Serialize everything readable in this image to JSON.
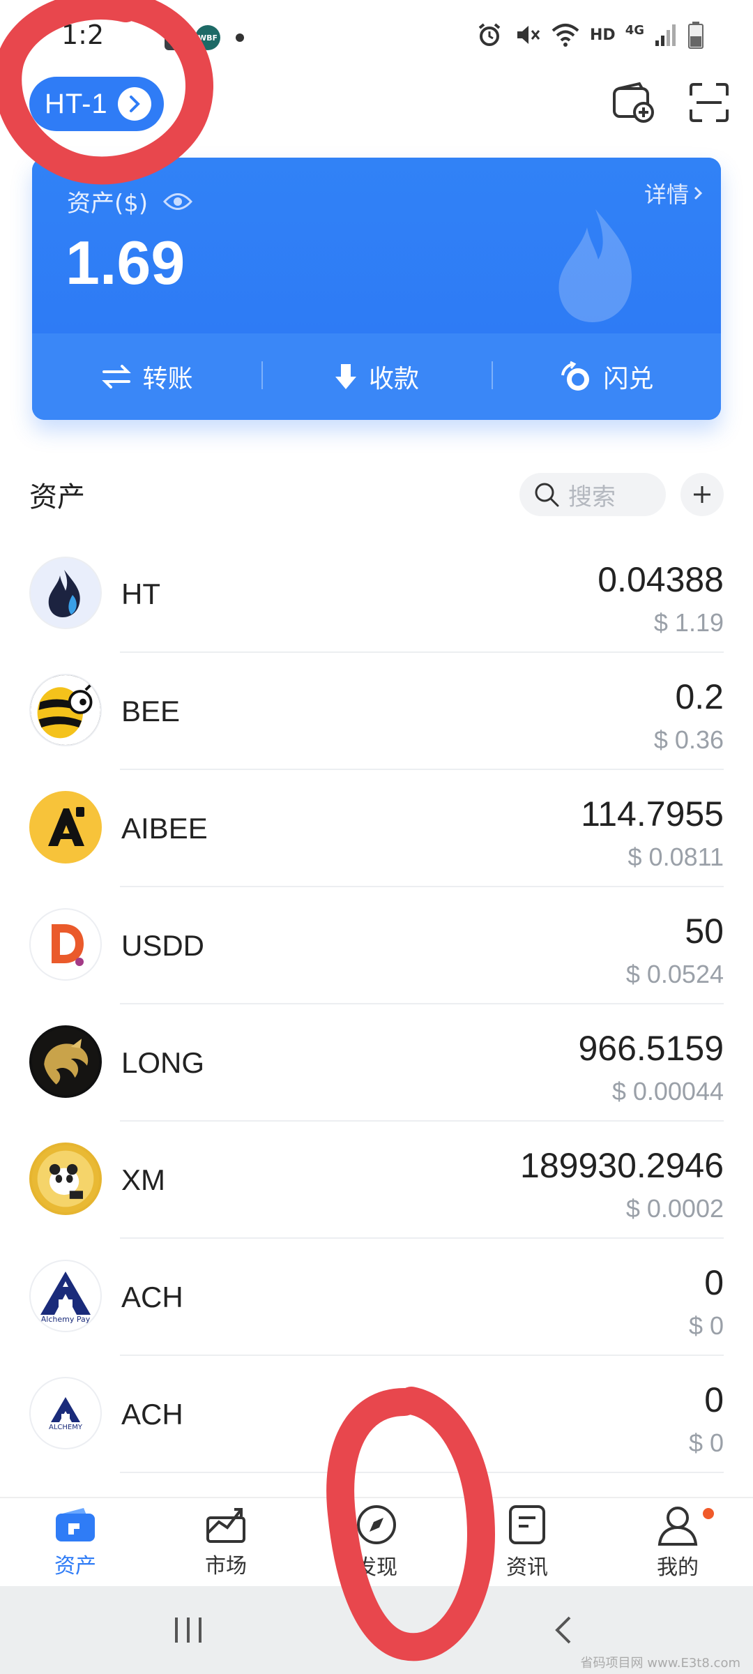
{
  "status_bar": {
    "time": "1:2",
    "app_badge": "WBF",
    "network_hd": "HD",
    "network_4g": "4G"
  },
  "header": {
    "wallet_name": "HT-1",
    "icons": [
      "wallet-add-icon",
      "scan-icon"
    ]
  },
  "balance_card": {
    "label": "资产($)",
    "value": "1.69",
    "detail_link": "详情",
    "actions": [
      {
        "label": "转账",
        "icon": "transfer-icon"
      },
      {
        "label": "收款",
        "icon": "receive-icon"
      },
      {
        "label": "闪兑",
        "icon": "swap-icon"
      }
    ]
  },
  "assets": {
    "title": "资产",
    "search_placeholder": "搜索",
    "items": [
      {
        "symbol": "HT",
        "amount": "0.04388",
        "usd": "$ 1.19"
      },
      {
        "symbol": "BEE",
        "amount": "0.2",
        "usd": "$ 0.36"
      },
      {
        "symbol": "AIBEE",
        "amount": "114.7955",
        "usd": "$ 0.0811"
      },
      {
        "symbol": "USDD",
        "amount": "50",
        "usd": "$ 0.0524"
      },
      {
        "symbol": "LONG",
        "amount": "966.5159",
        "usd": "$ 0.00044"
      },
      {
        "symbol": "XM",
        "amount": "189930.2946",
        "usd": "$ 0.0002"
      },
      {
        "symbol": "ACH",
        "amount": "0",
        "usd": "$ 0",
        "logo_text": "Alchemy Pay"
      },
      {
        "symbol": "ACH",
        "amount": "0",
        "usd": "$ 0",
        "logo_text": "ALCHEMY"
      }
    ]
  },
  "bottom_nav": [
    {
      "label": "资产",
      "icon": "wallet-icon",
      "active": true
    },
    {
      "label": "市场",
      "icon": "chart-icon",
      "active": false
    },
    {
      "label": "发现",
      "icon": "compass-icon",
      "active": false
    },
    {
      "label": "资讯",
      "icon": "news-icon",
      "active": false
    },
    {
      "label": "我的",
      "icon": "profile-icon",
      "active": false
    }
  ],
  "watermark": "省码项目网 www.E3t8.com",
  "colors": {
    "accent": "#2f7cf6",
    "annotation": "#e8474d"
  }
}
